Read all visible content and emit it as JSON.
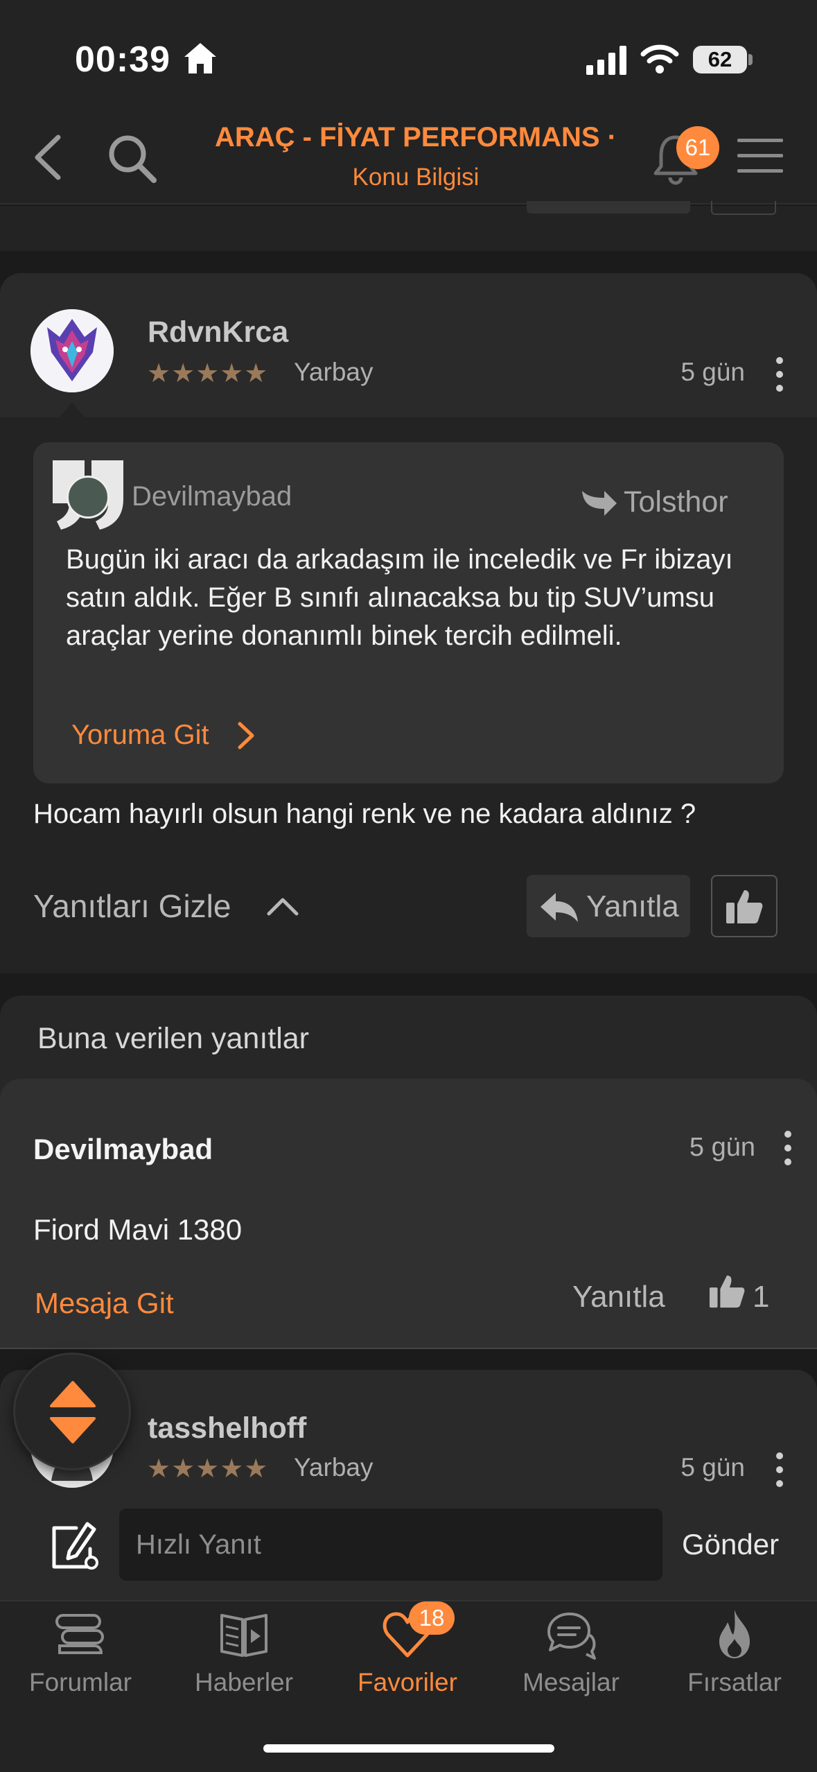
{
  "status_bar": {
    "time": "00:39",
    "battery": "62"
  },
  "nav": {
    "title": "ARAÇ  - FİYAT PERFORMANS ·",
    "subtitle": "Konu Bilgisi",
    "notification_count": "61"
  },
  "post": {
    "username": "RdvnKrca",
    "stars": "★★★★★",
    "rank": "Yarbay",
    "time": "5 gün",
    "quote": {
      "author": "Devilmaybad",
      "reply_to": "Tolsthor",
      "text": "Bugün iki aracı da arkadaşım ile inceledik ve Fr ibizayı satın aldık. Eğer B sınıfı alınacaksa bu tip SUV’umsu araçlar yerine donanımlı binek tercih edilmeli.",
      "goto_label": "Yoruma Git"
    },
    "text": "Hocam hayırlı olsun hangi renk ve ne kadara aldınız ?",
    "hide_replies_label": "Yanıtları Gizle",
    "reply_label": "Yanıtla"
  },
  "replies": {
    "header": "Buna verilen yanıtlar",
    "items": [
      {
        "username": "Devilmaybad",
        "time": "5 gün",
        "text": "Fiord Mavi 1380",
        "goto_label": "Mesaja Git",
        "reply_label": "Yanıtla",
        "likes": "1"
      }
    ]
  },
  "next_post": {
    "username": "tasshelhoff",
    "stars": "★★★★★",
    "rank": "Yarbay",
    "time": "5 gün"
  },
  "quick_reply": {
    "placeholder": "Hızlı Yanıt",
    "send_label": "Gönder"
  },
  "tabs": [
    {
      "label": "Forumlar",
      "icon": "forums-icon",
      "active": false
    },
    {
      "label": "Haberler",
      "icon": "news-icon",
      "active": false
    },
    {
      "label": "Favoriler",
      "icon": "heart-icon",
      "active": true,
      "badge": "18"
    },
    {
      "label": "Mesajlar",
      "icon": "messages-icon",
      "active": false
    },
    {
      "label": "Fırsatlar",
      "icon": "flame-icon",
      "active": false
    }
  ],
  "colors": {
    "accent": "#ff8a3d",
    "background": "#1b1b1b",
    "card": "#232323"
  }
}
